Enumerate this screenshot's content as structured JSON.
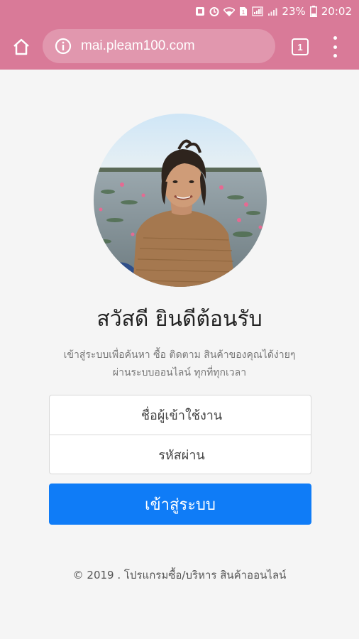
{
  "status_bar": {
    "battery_percent": "23%",
    "time": "20:02"
  },
  "browser": {
    "url": "mai.pleam100.com",
    "tab_count": "1"
  },
  "login": {
    "title": "สวัสดี ยินดีต้อนรับ",
    "subtitle_line1": "เข้าสู่ระบบเพื่อค้นหา ซื้อ ติดตาม สินค้าของคุณได้ง่ายๆ",
    "subtitle_line2": "ผ่านระบบออนไลน์ ทุกที่ทุกเวลา",
    "username_placeholder": "ชื่อผู้เข้าใช้งาน",
    "password_placeholder": "รหัสผ่าน",
    "login_button": "เข้าสู่ระบบ"
  },
  "footer": {
    "text": "© 2019 . โปรแกรมซื้อ/บริหาร สินค้าออนไลน์"
  },
  "colors": {
    "browser_bar": "#d97a98",
    "primary_button": "#0f7cf7",
    "page_background": "#f5f5f5"
  },
  "icons": {
    "home": "home-icon",
    "info": "info-icon",
    "menu": "more-vert-icon",
    "wifi": "wifi-icon",
    "signal": "signal-icon",
    "battery": "battery-icon"
  }
}
